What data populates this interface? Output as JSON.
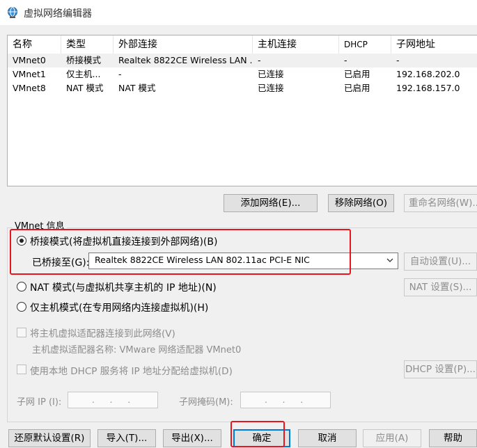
{
  "window": {
    "title": "虚拟网络编辑器"
  },
  "table": {
    "headers": [
      "名称",
      "类型",
      "外部连接",
      "主机连接",
      "DHCP",
      "子网地址"
    ],
    "rows": [
      [
        "VMnet0",
        "桥接模式",
        "Realtek 8822CE Wireless LAN ...",
        "-",
        "-",
        "-"
      ],
      [
        "VMnet1",
        "仅主机...",
        "-",
        "已连接",
        "已启用",
        "192.168.202.0"
      ],
      [
        "VMnet8",
        "NAT 模式",
        "NAT 模式",
        "已连接",
        "已启用",
        "192.168.157.0"
      ]
    ]
  },
  "network_buttons": {
    "add": "添加网络(E)...",
    "remove": "移除网络(O)",
    "rename": "重命名网络(W)..."
  },
  "vmnet_info": {
    "label": "VMnet 信息",
    "bridged": "桥接模式(将虚拟机直接连接到外部网络)(B)",
    "bridged_to_label": "已桥接至(G):",
    "bridged_to_value": "Realtek 8822CE Wireless LAN 802.11ac PCI-E NIC",
    "auto_settings": "自动设置(U)...",
    "nat": "NAT 模式(与虚拟机共享主机的 IP 地址)(N)",
    "nat_settings": "NAT 设置(S)...",
    "host_only": "仅主机模式(在专用网络内连接虚拟机)(H)",
    "connect_adapter": "将主机虚拟适配器连接到此网络(V)",
    "adapter_name": "主机虚拟适配器名称: VMware 网络适配器 VMnet0",
    "use_dhcp": "使用本地 DHCP 服务将 IP 地址分配给虚拟机(D)",
    "dhcp_settings": "DHCP 设置(P)...",
    "subnet_ip_label": "子网 IP (I):",
    "subnet_ip_value": ". . .",
    "subnet_mask_label": "子网掩码(M):",
    "subnet_mask_value": ". . ."
  },
  "footer_buttons": {
    "restore": "还原默认设置(R)",
    "import": "导入(T)...",
    "export": "导出(X)...",
    "ok": "确定",
    "cancel": "取消",
    "apply": "应用(A)",
    "help": "帮助"
  },
  "colors": {
    "highlight": "#e8161c",
    "focus": "#0078d7",
    "window_bg": "#f0f0f0"
  }
}
